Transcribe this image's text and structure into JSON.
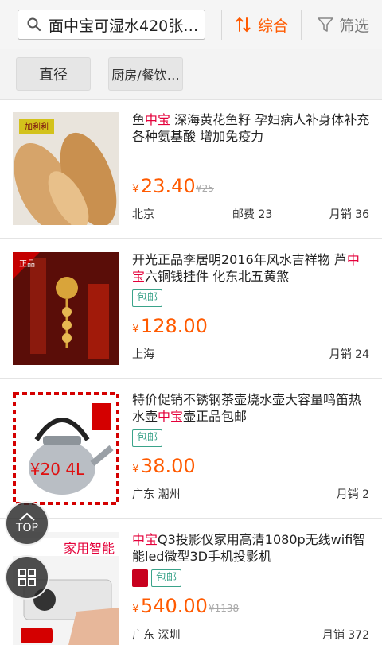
{
  "header": {
    "search_query": "面中宝可湿水420张…",
    "sort_label": "综合",
    "filter_label": "筛选"
  },
  "tags": [
    "直径",
    "厨房/餐饮…"
  ],
  "items": [
    {
      "title_parts": [
        "鱼",
        "中宝",
        " 深海黄花鱼籽 孕妇病人补身体补充各种氨基酸 增加免疫力"
      ],
      "badge": "",
      "price": "23.40",
      "old_price": "¥25",
      "location": "北京",
      "postage": "邮费 23",
      "monthly_sales": "月销 36",
      "thumb_caption": "加利利"
    },
    {
      "title_parts": [
        "开光正品李居明2016年风水吉祥物 芦",
        "中宝",
        "六铜钱挂件 化东北五黄煞"
      ],
      "badge": "包邮",
      "price": "128.00",
      "old_price": "",
      "location": "上海",
      "postage": "",
      "monthly_sales": "月销 24",
      "thumb_caption": "正品"
    },
    {
      "title_parts": [
        "特价促销不锈钢茶壶烧水壶大容量鸣笛热水壶",
        "中宝",
        "壶正品包邮"
      ],
      "badge": "包邮",
      "price": "38.00",
      "old_price": "",
      "location": "广东 潮州",
      "postage": "",
      "monthly_sales": "月销 2",
      "thumb_caption": "¥20 4L"
    },
    {
      "title_parts": [
        "",
        "中宝",
        "Q3投影仪家用高清1080p无线wifi智能led微型3D手机投影机"
      ],
      "badge": "包邮",
      "price": "540.00",
      "old_price": "¥1138",
      "location": "广东 深圳",
      "postage": "",
      "monthly_sales": "月销 372",
      "thumb_caption": "家用智能"
    }
  ],
  "fab": {
    "top_label": "TOP"
  },
  "colors": {
    "accent": "#ff5a00",
    "highlight": "#e4003a",
    "badge": "#3aa38a"
  }
}
